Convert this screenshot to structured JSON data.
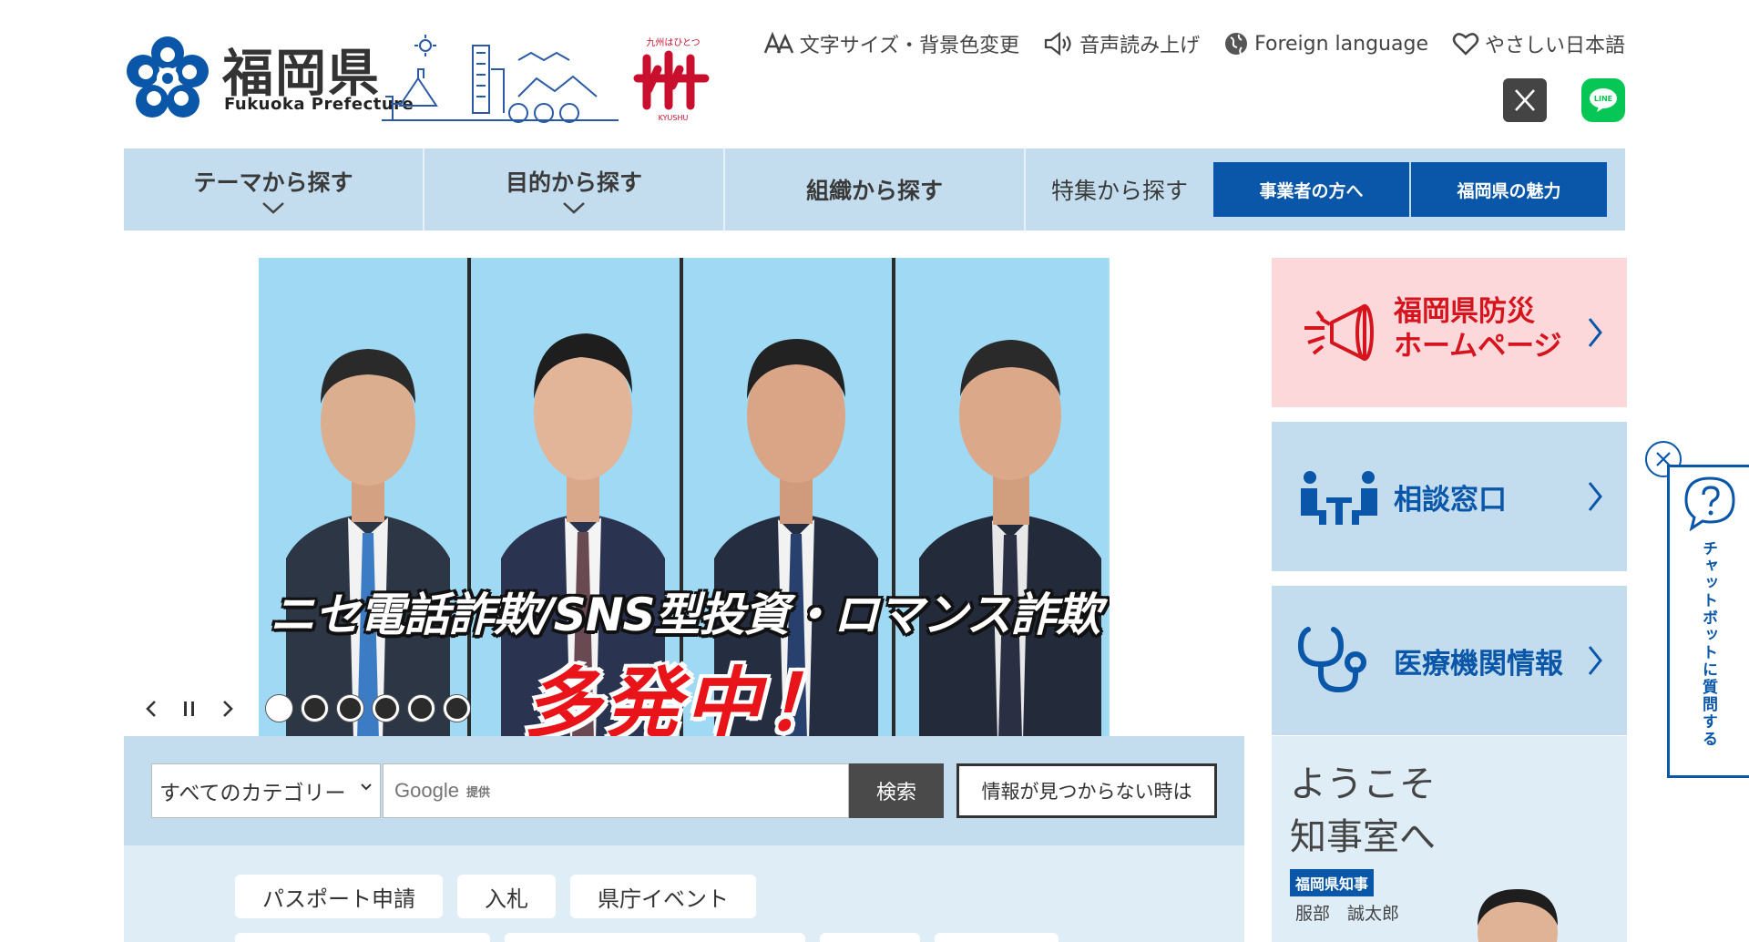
{
  "header": {
    "logo_name": "福岡県",
    "logo_en": "Fukuoka Prefecture",
    "kyushu_tagline": "九州はひとつ",
    "kyushu_en": "KYUSHU",
    "utility_links": [
      {
        "label": "文字サイズ・背景色変更",
        "icon": "font-size-icon"
      },
      {
        "label": "音声読み上げ",
        "icon": "speaker-icon"
      },
      {
        "label": "Foreign language",
        "icon": "globe-icon"
      },
      {
        "label": "やさしい日本語",
        "icon": "heart-icon"
      }
    ],
    "sns": [
      {
        "name": "X",
        "icon": "x-icon",
        "color": "#444444"
      },
      {
        "name": "LINE",
        "icon": "line-icon",
        "color": "#06c755"
      }
    ]
  },
  "nav": {
    "items": [
      {
        "label": "テーマから探す",
        "has_dropdown": true
      },
      {
        "label": "目的から探す",
        "has_dropdown": true
      },
      {
        "label": "組織から探す",
        "has_dropdown": false
      },
      {
        "label": "特集から探す",
        "has_dropdown": false
      }
    ],
    "blue_buttons": [
      {
        "label": "事業者の方へ"
      },
      {
        "label": "福岡県の魅力"
      }
    ],
    "accent_color": "#0a56a8",
    "bar_color": "#c3ddee"
  },
  "hero": {
    "caption_line1": "ニセ電話詐欺/SNS型投資・ロマンス詐欺",
    "caption_line2": "多発中！",
    "slide_count": 6,
    "active_slide": 1,
    "controls": {
      "prev": "‹",
      "pause": "II",
      "next": "›"
    }
  },
  "search": {
    "category_selected": "すべてのカテゴリー",
    "google_label": "Google",
    "provided_label": "提供",
    "search_button": "検索",
    "not_found_button": "情報が見つからない時は"
  },
  "tags": [
    "パスポート申請",
    "入札",
    "県庁イベント"
  ],
  "side_cards": [
    {
      "label_line1": "福岡県防災",
      "label_line2": "ホームページ",
      "icon": "megaphone-icon",
      "color": "#d5141e"
    },
    {
      "label": "相談窓口",
      "icon": "consultation-icon",
      "color": "#0a56a8"
    },
    {
      "label": "医療機関情報",
      "icon": "stethoscope-icon",
      "color": "#0a56a8"
    }
  ],
  "governor": {
    "title_line1": "ようこそ",
    "title_line2": "知事室へ",
    "badge": "福岡県知事",
    "name": "服部　誠太郎"
  },
  "chatbot": {
    "label": "チャットボットに質問する",
    "close_icon": "close-icon"
  }
}
